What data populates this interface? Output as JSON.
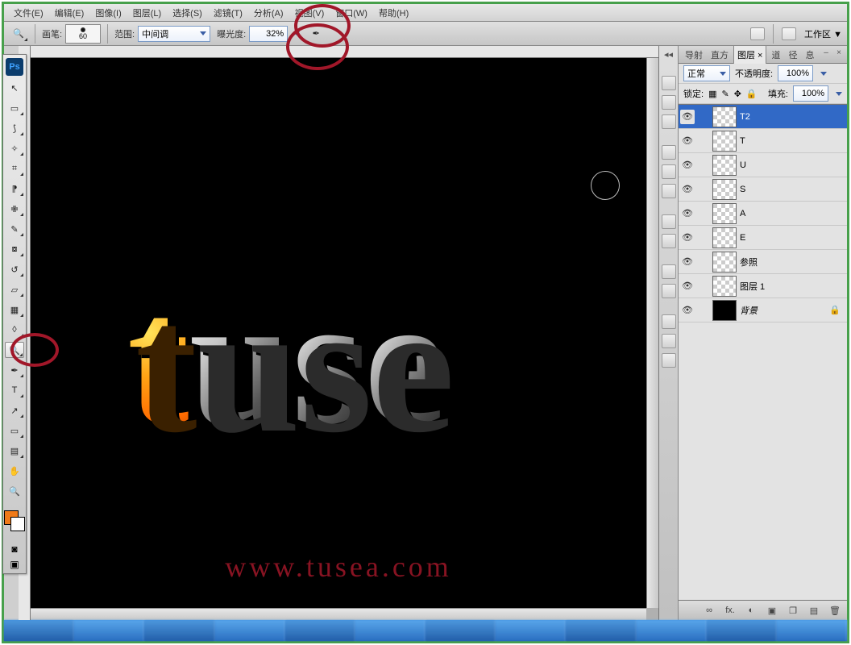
{
  "menu": [
    "文件(E)",
    "编辑(E)",
    "图像(I)",
    "图层(L)",
    "选择(S)",
    "滤镜(T)",
    "分析(A)",
    "视图(V)",
    "窗口(W)",
    "帮助(H)"
  ],
  "options": {
    "brush_label": "画笔:",
    "brush_size": "60",
    "range_label": "范围:",
    "range_value": "中间调",
    "exposure_label": "曝光度:",
    "exposure_value": "32%",
    "workspace_label": "工作区 ▼"
  },
  "panel": {
    "tabs": [
      "导射",
      "直方",
      "图层 ×",
      "道",
      "径",
      "息"
    ],
    "blend_mode": "正常",
    "opacity_label": "不透明度:",
    "opacity_value": "100%",
    "lock_label": "锁定:",
    "fill_label": "填充:",
    "fill_value": "100%"
  },
  "layers": [
    {
      "name": "T2",
      "sel": true,
      "thumb": "check"
    },
    {
      "name": "T",
      "thumb": "check"
    },
    {
      "name": "U",
      "thumb": "check"
    },
    {
      "name": "S",
      "thumb": "check"
    },
    {
      "name": "A",
      "thumb": "check"
    },
    {
      "name": "E",
      "thumb": "check"
    },
    {
      "name": "参照",
      "thumb": "check"
    },
    {
      "name": "图层 1",
      "thumb": "check"
    },
    {
      "name": "背景",
      "thumb": "black",
      "bg": true
    }
  ],
  "footer_icons": [
    "∞",
    "fx.",
    "◐",
    "▣",
    "❐",
    "▤",
    "🗑"
  ],
  "canvas": {
    "text": "tuse",
    "watermark": "www.tusea.com"
  },
  "colors": {
    "fg": "#f07a18",
    "bg": "#ffffff",
    "accent": "#3169c6",
    "annotation": "#a11729"
  }
}
